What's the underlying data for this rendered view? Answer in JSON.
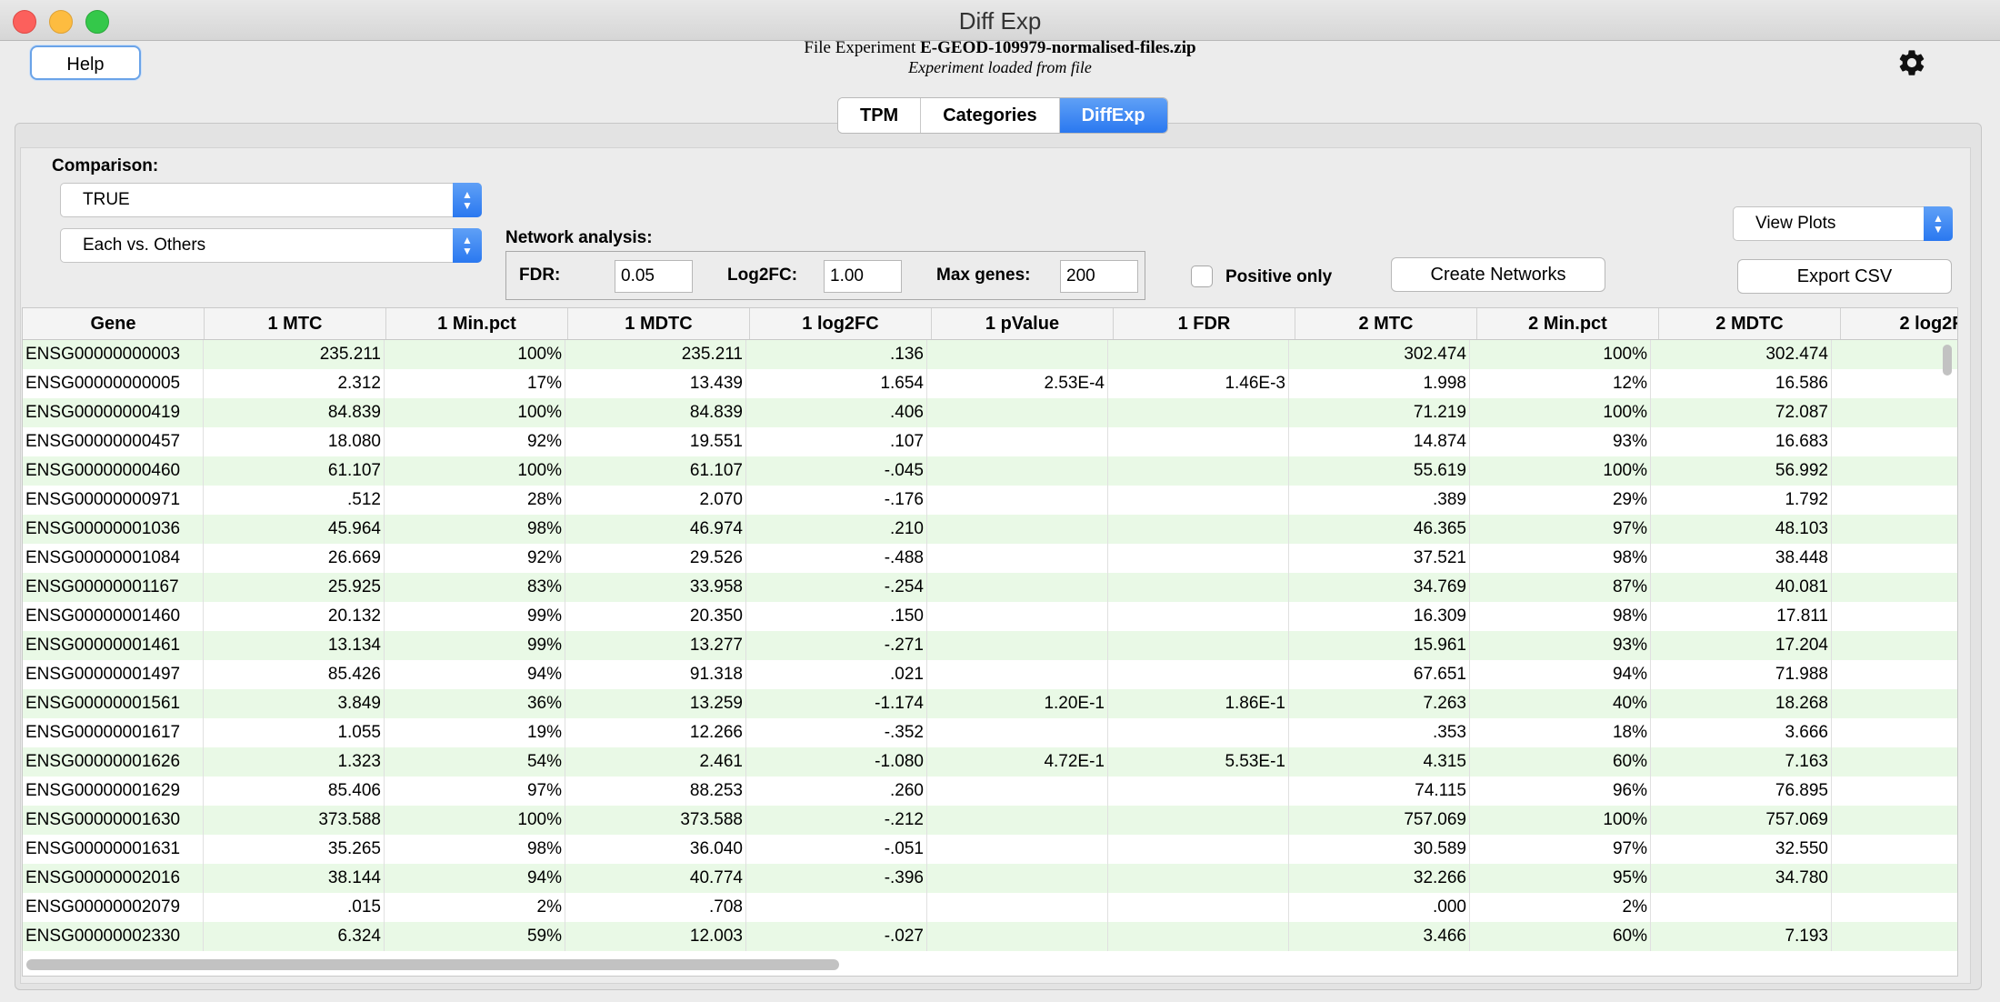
{
  "window": {
    "title": "Diff Exp"
  },
  "header": {
    "help_label": "Help",
    "file_prefix": "File Experiment",
    "file_name": "E-GEOD-109979-normalised-files.zip",
    "status": "Experiment loaded from file"
  },
  "tabs": [
    {
      "label": "TPM",
      "active": false
    },
    {
      "label": "Categories",
      "active": false
    },
    {
      "label": "DiffExp",
      "active": true
    }
  ],
  "controls": {
    "comparison_label": "Comparison:",
    "comparison_value": "TRUE",
    "mode_value": "Each vs. Others",
    "network_label": "Network analysis:",
    "fdr_label": "FDR:",
    "fdr_value": "0.05",
    "log2fc_label": "Log2FC:",
    "log2fc_value": "1.00",
    "maxgenes_label": "Max genes:",
    "maxgenes_value": "200",
    "positive_only_label": "Positive only",
    "positive_only_checked": false,
    "create_networks_label": "Create Networks",
    "view_plots_value": "View Plots",
    "export_csv_label": "Export CSV"
  },
  "accent_color": "#2a78f0",
  "row_highlight_color": "#e9f9e6",
  "table": {
    "columns": [
      "Gene",
      "1 MTC",
      "1 Min.pct",
      "1 MDTC",
      "1 log2FC",
      "1 pValue",
      "1 FDR",
      "2 MTC",
      "2 Min.pct",
      "2 MDTC",
      "2 log2F"
    ],
    "rows": [
      [
        "ENSG00000000003",
        "235.211",
        "100%",
        "235.211",
        ".136",
        "",
        "",
        "302.474",
        "100%",
        "302.474",
        ""
      ],
      [
        "ENSG00000000005",
        "2.312",
        "17%",
        "13.439",
        "1.654",
        "2.53E-4",
        "1.46E-3",
        "1.998",
        "12%",
        "16.586",
        ""
      ],
      [
        "ENSG00000000419",
        "84.839",
        "100%",
        "84.839",
        ".406",
        "",
        "",
        "71.219",
        "100%",
        "72.087",
        ""
      ],
      [
        "ENSG00000000457",
        "18.080",
        "92%",
        "19.551",
        ".107",
        "",
        "",
        "14.874",
        "93%",
        "16.683",
        ""
      ],
      [
        "ENSG00000000460",
        "61.107",
        "100%",
        "61.107",
        "-.045",
        "",
        "",
        "55.619",
        "100%",
        "56.992",
        ""
      ],
      [
        "ENSG00000000971",
        ".512",
        "28%",
        "2.070",
        "-.176",
        "",
        "",
        ".389",
        "29%",
        "1.792",
        ""
      ],
      [
        "ENSG00000001036",
        "45.964",
        "98%",
        "46.974",
        ".210",
        "",
        "",
        "46.365",
        "97%",
        "48.103",
        ""
      ],
      [
        "ENSG00000001084",
        "26.669",
        "92%",
        "29.526",
        "-.488",
        "",
        "",
        "37.521",
        "98%",
        "38.448",
        ""
      ],
      [
        "ENSG00000001167",
        "25.925",
        "83%",
        "33.958",
        "-.254",
        "",
        "",
        "34.769",
        "87%",
        "40.081",
        ""
      ],
      [
        "ENSG00000001460",
        "20.132",
        "99%",
        "20.350",
        ".150",
        "",
        "",
        "16.309",
        "98%",
        "17.811",
        ""
      ],
      [
        "ENSG00000001461",
        "13.134",
        "99%",
        "13.277",
        "-.271",
        "",
        "",
        "15.961",
        "93%",
        "17.204",
        ""
      ],
      [
        "ENSG00000001497",
        "85.426",
        "94%",
        "91.318",
        ".021",
        "",
        "",
        "67.651",
        "94%",
        "71.988",
        ""
      ],
      [
        "ENSG00000001561",
        "3.849",
        "36%",
        "13.259",
        "-1.174",
        "1.20E-1",
        "1.86E-1",
        "7.263",
        "40%",
        "18.268",
        ""
      ],
      [
        "ENSG00000001617",
        "1.055",
        "19%",
        "12.266",
        "-.352",
        "",
        "",
        ".353",
        "18%",
        "3.666",
        ""
      ],
      [
        "ENSG00000001626",
        "1.323",
        "54%",
        "2.461",
        "-1.080",
        "4.72E-1",
        "5.53E-1",
        "4.315",
        "60%",
        "7.163",
        ""
      ],
      [
        "ENSG00000001629",
        "85.406",
        "97%",
        "88.253",
        ".260",
        "",
        "",
        "74.115",
        "96%",
        "76.895",
        ""
      ],
      [
        "ENSG00000001630",
        "373.588",
        "100%",
        "373.588",
        "-.212",
        "",
        "",
        "757.069",
        "100%",
        "757.069",
        ""
      ],
      [
        "ENSG00000001631",
        "35.265",
        "98%",
        "36.040",
        "-.051",
        "",
        "",
        "30.589",
        "97%",
        "32.550",
        ""
      ],
      [
        "ENSG00000002016",
        "38.144",
        "94%",
        "40.774",
        "-.396",
        "",
        "",
        "32.266",
        "95%",
        "34.780",
        ""
      ],
      [
        "ENSG00000002079",
        ".015",
        "2%",
        ".708",
        "",
        "",
        "",
        ".000",
        "2%",
        "",
        ""
      ],
      [
        "ENSG00000002330",
        "6.324",
        "59%",
        "12.003",
        "-.027",
        "",
        "",
        "3.466",
        "60%",
        "7.193",
        ""
      ]
    ]
  }
}
